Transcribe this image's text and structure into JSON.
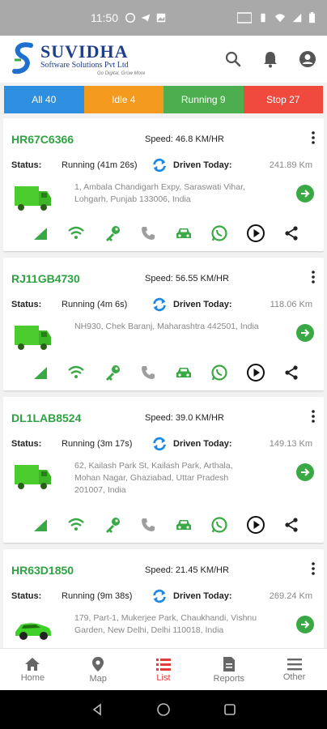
{
  "statusbar": {
    "time": "11:50"
  },
  "brand": {
    "name": "SUVIDHA",
    "subtitle": "Software Solutions Pvt Ltd",
    "tagline": "Go Digital, Grow More"
  },
  "filters": [
    {
      "label": "All 40",
      "color": "#2e8fe0"
    },
    {
      "label": "Idle 4",
      "color": "#f49a1f"
    },
    {
      "label": "Running 9",
      "color": "#4cae4f"
    },
    {
      "label": "Stop 27",
      "color": "#f04a3f"
    }
  ],
  "labels": {
    "status": "Status:",
    "driven_today": "Driven Today:"
  },
  "vehicles": [
    {
      "number": "HR67C6366",
      "speed": "Speed: 46.8 KM/HR",
      "status": "Running (41m 26s)",
      "driven": "241.89 Km",
      "address": "1, Ambala Chandigarh Expy, Saraswati Vihar, Lohgarh, Punjab 133006, India",
      "type": "truck"
    },
    {
      "number": "RJ11GB4730",
      "speed": "Speed: 56.55 KM/HR",
      "status": "Running (4m 6s)",
      "driven": "118.06 Km",
      "address": "NH930, Chek Baranj, Maharashtra 442501, India",
      "type": "truck"
    },
    {
      "number": "DL1LAB8524",
      "speed": "Speed: 39.0 KM/HR",
      "status": "Running (3m 17s)",
      "driven": "149.13 Km",
      "address": "62, Kailash Park St, Kailash Park, Arthala, Mohan Nagar, Ghaziabad, Uttar Pradesh 201007, India",
      "type": "truck"
    },
    {
      "number": "HR63D1850",
      "speed": "Speed: 21.45 KM/HR",
      "status": "Running (9m 38s)",
      "driven": "269.24 Km",
      "address": "179, Part-1, Mukerjee Park, Chaukhandi, Vishnu Garden, New Delhi, Delhi 110018, India",
      "type": "car"
    }
  ],
  "nav": [
    {
      "label": "Home",
      "icon": "home-icon"
    },
    {
      "label": "Map",
      "icon": "map-pin-icon"
    },
    {
      "label": "List",
      "icon": "list-icon",
      "active": true
    },
    {
      "label": "Reports",
      "icon": "report-icon"
    },
    {
      "label": "Other",
      "icon": "menu-icon"
    }
  ]
}
